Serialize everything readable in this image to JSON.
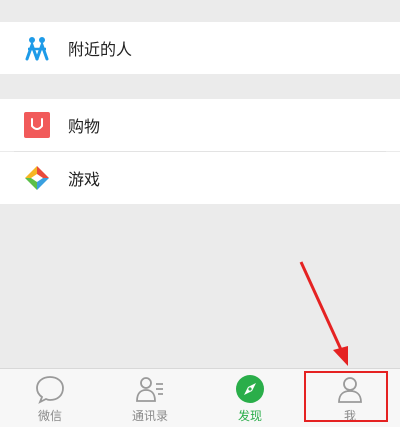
{
  "discover": {
    "items": [
      {
        "label": "附近的人",
        "icon": "people-nearby-icon"
      },
      {
        "label": "购物",
        "icon": "shopping-bag-icon"
      },
      {
        "label": "游戏",
        "icon": "game-diamond-icon"
      }
    ]
  },
  "tabbar": {
    "tabs": [
      {
        "label": "微信",
        "icon": "chat-bubble-icon",
        "active": false
      },
      {
        "label": "通讯录",
        "icon": "contacts-icon",
        "active": false
      },
      {
        "label": "发现",
        "icon": "compass-icon",
        "active": true
      },
      {
        "label": "我",
        "icon": "person-icon",
        "active": false
      }
    ]
  },
  "colors": {
    "accent": "#2aae4a",
    "annotation": "#e52222",
    "shop_icon": "#f15a5a",
    "nearby_icon": "#1e9be8"
  }
}
